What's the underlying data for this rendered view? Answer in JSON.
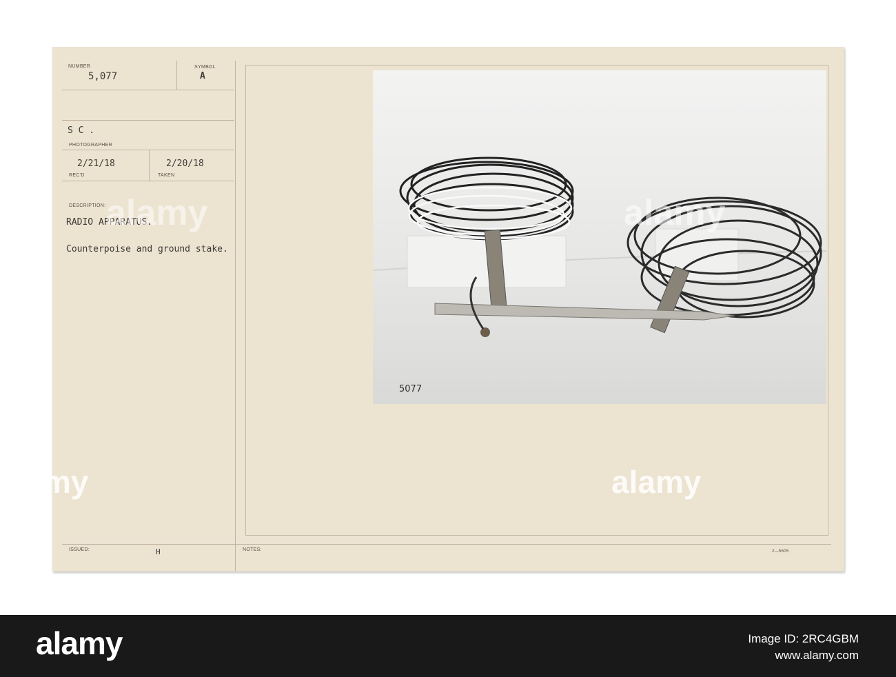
{
  "card": {
    "number_label": "NUMBER",
    "number_value": "5,077",
    "symbol_label": "SYMBOL",
    "symbol_value": "A",
    "photographer_value": "S C .",
    "photographer_label": "PHOTOGRAPHER",
    "recd_value": "2/21/18",
    "recd_label": "REC'D",
    "taken_value": "2/20/18",
    "taken_label": "TAKEN",
    "description_label": "DESCRIPTION:",
    "description_title": "RADIO APPARATUS.",
    "description_text": "Counterpoise and ground stake.",
    "issued_label": "ISSUED:",
    "issued_value": "H",
    "notes_label": "NOTES:",
    "form_code": "2—5605"
  },
  "photo": {
    "plate_number": "5077"
  },
  "watermark": "alamy",
  "footer": {
    "logo": "alamy",
    "image_id_label": "Image ID: 2RC4GBM",
    "url": "www.alamy.com"
  }
}
